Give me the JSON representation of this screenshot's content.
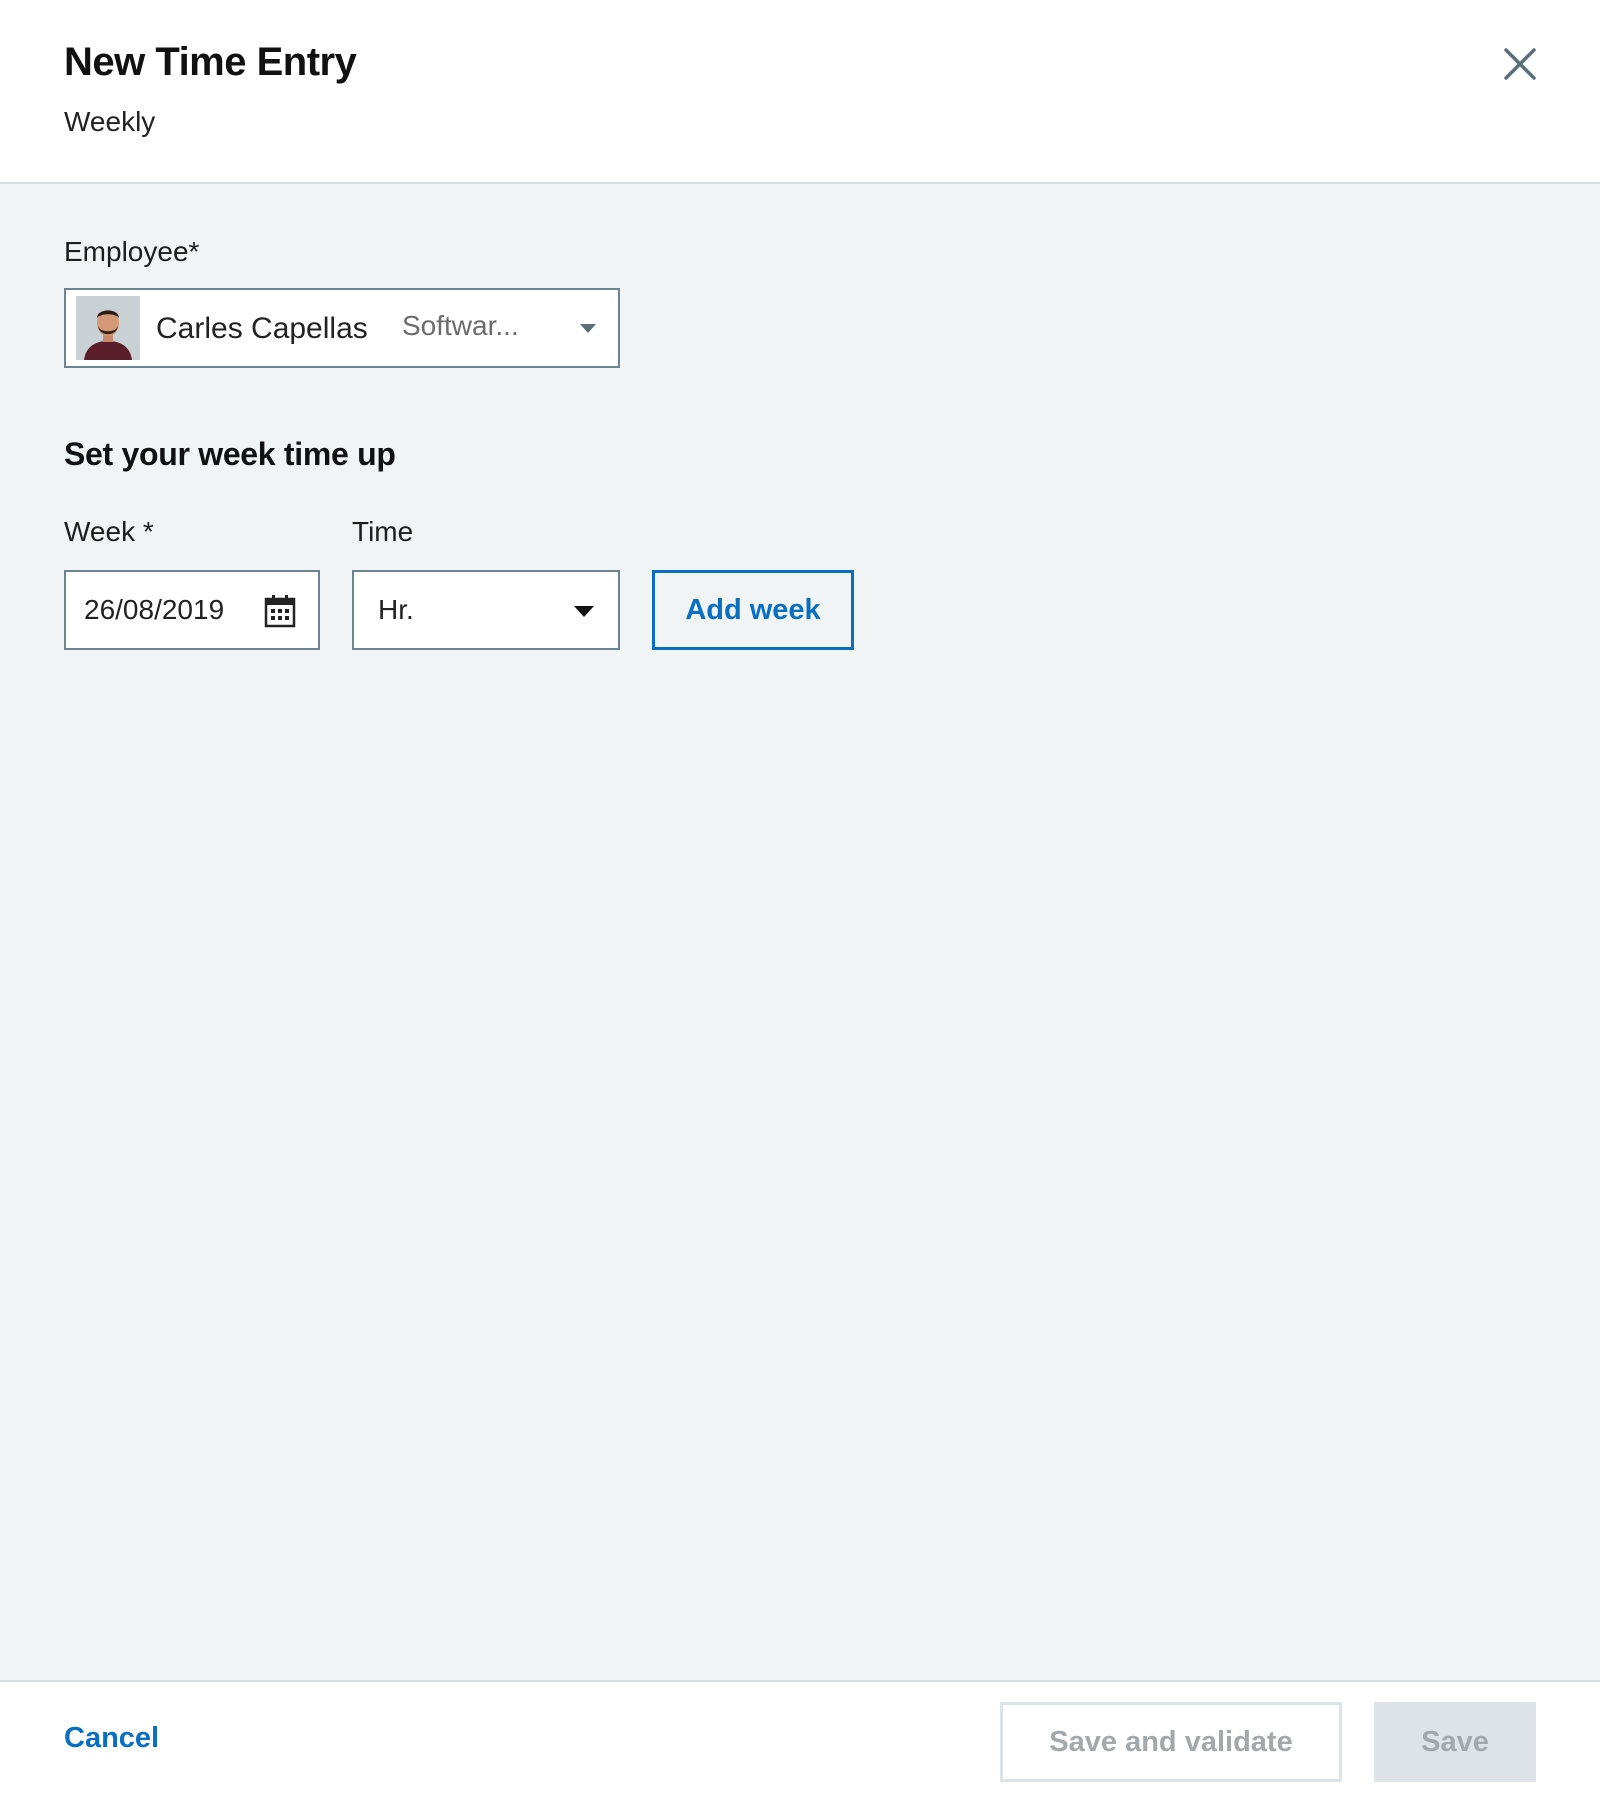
{
  "header": {
    "title": "New Time Entry",
    "subtitle": "Weekly",
    "close_icon": "close-icon"
  },
  "form": {
    "employee": {
      "label": "Employee*",
      "name": "Carles Capellas",
      "role": "Softwar...",
      "avatar_icon": "avatar"
    },
    "section_heading": "Set your week time up",
    "week": {
      "label": "Week *",
      "value": "26/08/2019",
      "icon": "calendar-icon"
    },
    "time": {
      "label": "Time",
      "value": "Hr."
    },
    "add_week_label": "Add week"
  },
  "footer": {
    "cancel_label": "Cancel",
    "save_validate_label": "Save and validate",
    "save_label": "Save"
  },
  "colors": {
    "accent": "#0a6fc2",
    "body_bg": "#f0f4f5",
    "input_border": "#6d8592",
    "disabled_text": "#a2a8ab",
    "disabled_bg": "#dde3e6"
  }
}
